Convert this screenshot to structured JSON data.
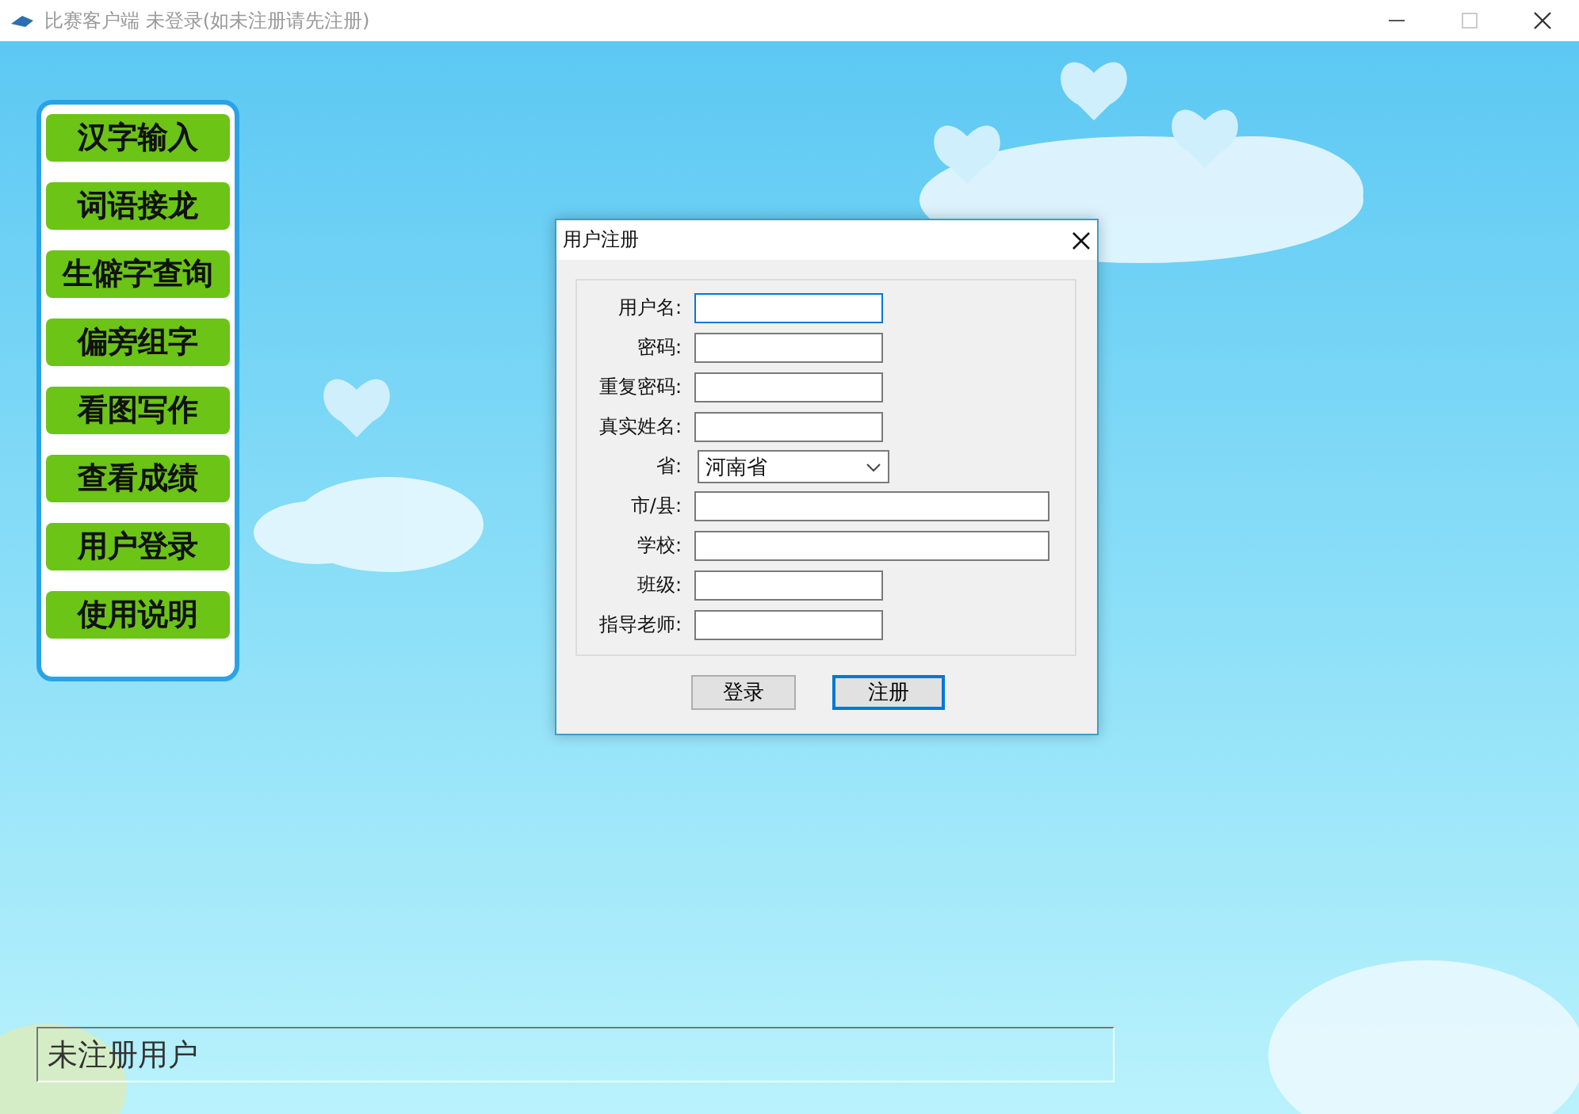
{
  "window": {
    "title": "比赛客户端 未登录(如未注册请先注册)",
    "maximize_disabled": true
  },
  "menu": [
    {
      "label": "汉字输入"
    },
    {
      "label": "词语接龙"
    },
    {
      "label": "生僻字查询"
    },
    {
      "label": "偏旁组字"
    },
    {
      "label": "看图写作"
    },
    {
      "label": "查看成绩"
    },
    {
      "label": "用户登录"
    },
    {
      "label": "使用说明"
    }
  ],
  "dialog": {
    "title": "用户注册",
    "fields": [
      {
        "label": "用户名:",
        "kind": "short",
        "focused": true
      },
      {
        "label": "密码:",
        "kind": "short",
        "focused": false
      },
      {
        "label": "重复密码:",
        "kind": "short",
        "focused": false
      },
      {
        "label": "真实姓名:",
        "kind": "short",
        "focused": false
      },
      {
        "label": "省:",
        "kind": "select",
        "value": "河南省",
        "focused": false
      },
      {
        "label": "市/县:",
        "kind": "long",
        "focused": false
      },
      {
        "label": "学校:",
        "kind": "long",
        "focused": false
      },
      {
        "label": "班级:",
        "kind": "short",
        "focused": false
      },
      {
        "label": "指导老师:",
        "kind": "short",
        "focused": false
      }
    ],
    "buttons": [
      {
        "label": "登录",
        "default": false
      },
      {
        "label": "注册",
        "default": true
      }
    ]
  },
  "status": {
    "text": "未注册用户"
  }
}
